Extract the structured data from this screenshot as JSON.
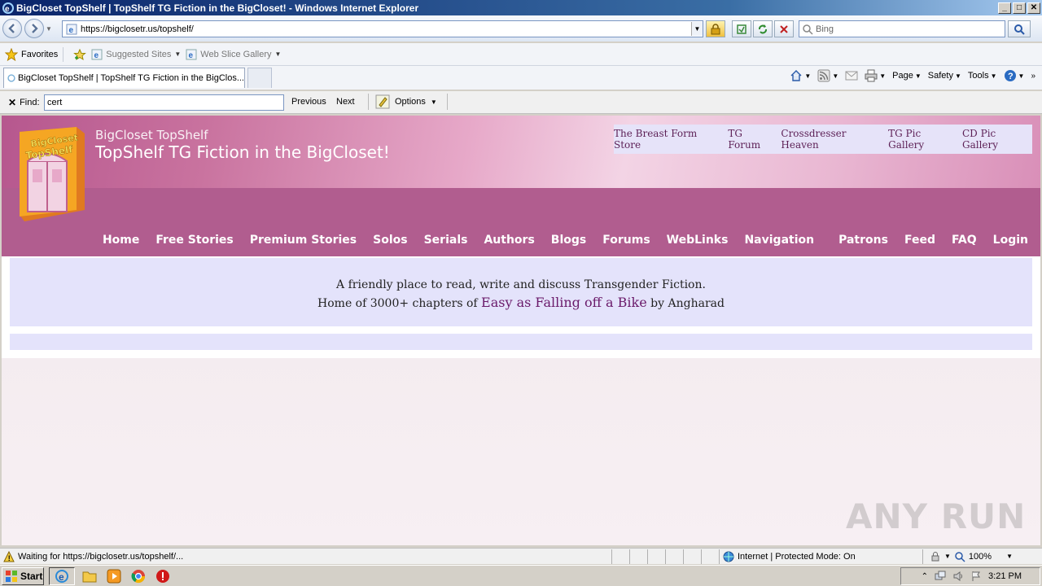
{
  "window": {
    "title": "BigCloset TopShelf | TopShelf TG Fiction in the BigCloset! - Windows Internet Explorer",
    "controls": [
      "_",
      "□",
      "✕"
    ]
  },
  "address_bar": {
    "url": "https://bigclosetr.us/topshelf/",
    "search_placeholder": "Bing"
  },
  "favorites_bar": {
    "favorites_label": "Favorites",
    "suggested_sites": "Suggested Sites",
    "web_slice_gallery": "Web Slice Gallery"
  },
  "tabs": {
    "active_tab_title": "BigCloset TopShelf | TopShelf TG Fiction in the BigClos..."
  },
  "command_bar": {
    "page": "Page",
    "safety": "Safety",
    "tools": "Tools"
  },
  "find_bar": {
    "label": "Find:",
    "query": "cert",
    "previous": "Previous",
    "next": "Next",
    "options": "Options"
  },
  "site": {
    "subtitle": "BigCloset TopShelf",
    "title": "TopShelf TG Fiction in the BigCloset!",
    "top_links": [
      "The Breast Form Store",
      "TG Forum",
      "Crossdresser Heaven",
      "TG Pic Gallery",
      "CD Pic Gallery"
    ],
    "nav": [
      "Home",
      "Free Stories",
      "Premium Stories",
      "Solos",
      "Serials",
      "Authors",
      "Blogs",
      "Forums",
      "WebLinks",
      "Navigation",
      "Patrons",
      "Feed",
      "FAQ",
      "Login"
    ],
    "welcome_line1": "A friendly place to read, write and discuss Transgender Fiction.",
    "welcome_line2_prefix": "Home of 3000+ chapters of",
    "welcome_book": "Easy as Falling off a Bike",
    "welcome_line2_suffix": "by Angharad",
    "logo_text": "BigCloset TopShelf"
  },
  "status_bar": {
    "message": "Waiting for https://bigclosetr.us/topshelf/...",
    "zone": "Internet | Protected Mode: On",
    "zoom": "100%"
  },
  "taskbar": {
    "start": "Start",
    "clock": "3:21 PM"
  },
  "watermark": "ANY RUN"
}
